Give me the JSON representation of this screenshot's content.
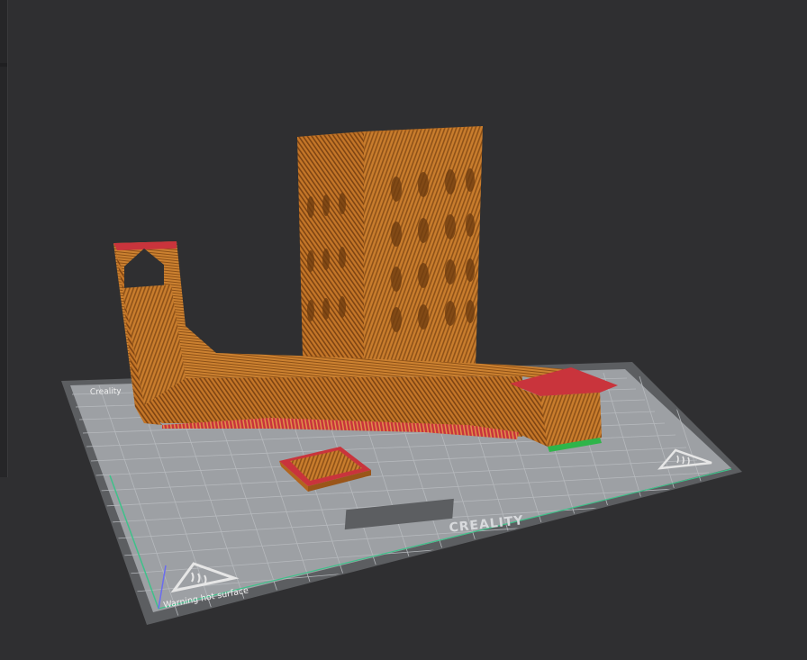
{
  "bed": {
    "brand_label": "CREALITY",
    "warning_text": "Warning hot surface",
    "corner_text": "Creality"
  },
  "models": [
    {
      "name": "tower"
    },
    {
      "name": "slide-ramp"
    },
    {
      "name": "square-plate"
    }
  ],
  "colors": {
    "background": "#2f2f31",
    "bed_surface": "#9b9ea2",
    "bed_grid": "#b4b7bb",
    "model_orange": "#c77a2a",
    "model_red_perimeter": "#c9343c",
    "support_green": "#2fb54a"
  }
}
